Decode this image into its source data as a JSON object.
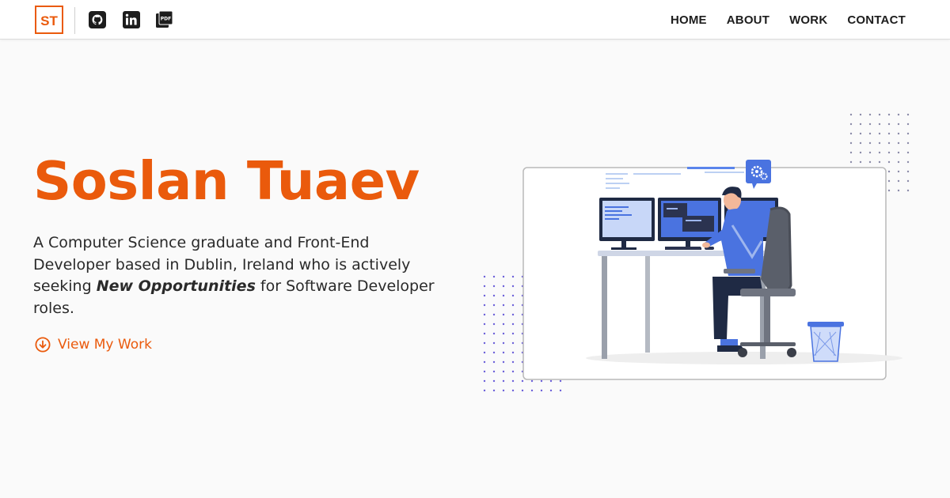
{
  "header": {
    "logo_text": "ST",
    "social": [
      {
        "name": "github",
        "icon": "github-icon"
      },
      {
        "name": "linkedin",
        "icon": "linkedin-icon",
        "label": "in"
      },
      {
        "name": "resume",
        "icon": "pdf-icon",
        "label": "PDF"
      }
    ],
    "nav": [
      "HOME",
      "ABOUT",
      "WORK",
      "CONTACT"
    ]
  },
  "hero": {
    "name": "Soslan Tuaev",
    "desc_part1": "A Computer Science graduate and Front-End Developer based in Dublin, Ireland who is actively seeking ",
    "desc_emphasis": "New Opportunities",
    "desc_part2": " for Software Developer roles.",
    "cta_label": "View My Work",
    "cta_icon": "arrow-down-circle-icon"
  },
  "colors": {
    "accent": "#ea5a0c",
    "illustration_blue": "#4a73e0",
    "dots": "#6b5fd9"
  }
}
